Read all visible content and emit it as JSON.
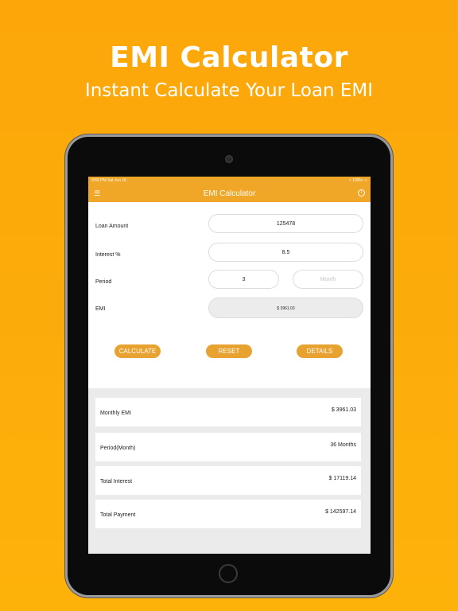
{
  "promo": {
    "title": "EMI Calculator",
    "subtitle": "Instant Calculate Your Loan EMI"
  },
  "status_bar": {
    "time": "9:55 PM",
    "date": "Sat Jun 16",
    "battery": "100%"
  },
  "navbar": {
    "title": "EMI Calculator",
    "menu_icon": "hamburger-icon",
    "info_icon": "info-icon"
  },
  "form": {
    "loan_amount_label": "Loan Amount",
    "loan_amount_value": "125478",
    "interest_label": "Interest %",
    "interest_value": "8.5",
    "period_label": "Period",
    "period_value": "3",
    "month_placeholder": "Month",
    "emi_label": "EMI",
    "emi_value": "$ 3961.03"
  },
  "buttons": {
    "calculate": "CALCULATE",
    "reset": "RESET",
    "details": "DETAILS"
  },
  "results": [
    {
      "label": "Monthly EMI",
      "value": "$ 3961.03"
    },
    {
      "label": "Period(Month)",
      "value": "36 Months"
    },
    {
      "label": "Total Interest",
      "value": "$ 17119.14"
    },
    {
      "label": "Total Payment",
      "value": "$ 142597.14"
    }
  ],
  "colors": {
    "background": "#fca60a",
    "accent": "#f0a626",
    "button": "#e8a230"
  }
}
